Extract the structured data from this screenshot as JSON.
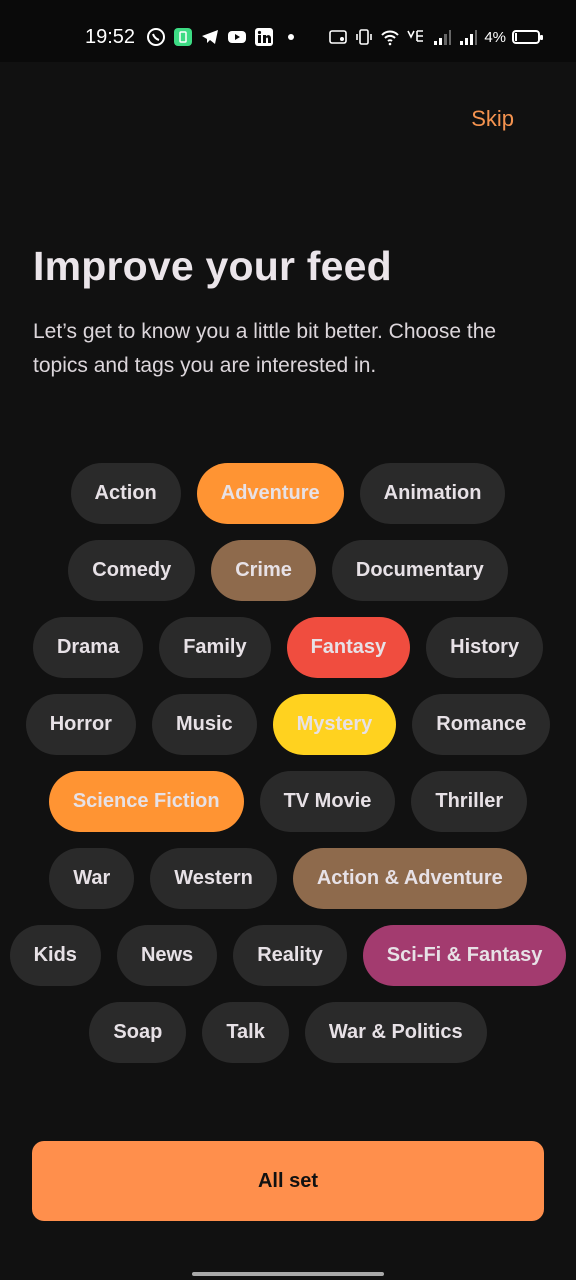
{
  "status_bar": {
    "time": "19:52",
    "battery_percent": "4%",
    "icons": [
      "whatsapp-icon",
      "battery-saver-icon",
      "telegram-icon",
      "youtube-icon",
      "linkedin-icon",
      "dot-icon",
      "cast-icon",
      "vibrate-icon",
      "wifi-icon",
      "volte-icon",
      "signal-icon",
      "signal-icon"
    ]
  },
  "header": {
    "skip_label": "Skip"
  },
  "main": {
    "title": "Improve your feed",
    "subtitle": "Let’s get to know you a little bit better. Choose the topics and tags you are interested in."
  },
  "tags": [
    [
      {
        "label": "Action",
        "selected": false,
        "color": "#2a2a2a"
      },
      {
        "label": "Adventure",
        "selected": true,
        "color": "#ff9433"
      },
      {
        "label": "Animation",
        "selected": false,
        "color": "#2a2a2a"
      }
    ],
    [
      {
        "label": "Comedy",
        "selected": false,
        "color": "#2a2a2a"
      },
      {
        "label": "Crime",
        "selected": true,
        "color": "#8e6a4c"
      },
      {
        "label": "Documentary",
        "selected": false,
        "color": "#2a2a2a"
      }
    ],
    [
      {
        "label": "Drama",
        "selected": false,
        "color": "#2a2a2a"
      },
      {
        "label": "Family",
        "selected": false,
        "color": "#2a2a2a"
      },
      {
        "label": "Fantasy",
        "selected": true,
        "color": "#f04d3f"
      },
      {
        "label": "History",
        "selected": false,
        "color": "#2a2a2a"
      }
    ],
    [
      {
        "label": "Horror",
        "selected": false,
        "color": "#2a2a2a"
      },
      {
        "label": "Music",
        "selected": false,
        "color": "#2a2a2a"
      },
      {
        "label": "Mystery",
        "selected": true,
        "color": "#ffd21f"
      },
      {
        "label": "Romance",
        "selected": false,
        "color": "#2a2a2a"
      }
    ],
    [
      {
        "label": "Science Fiction",
        "selected": true,
        "color": "#ff9433"
      },
      {
        "label": "TV Movie",
        "selected": false,
        "color": "#2a2a2a"
      },
      {
        "label": "Thriller",
        "selected": false,
        "color": "#2a2a2a"
      }
    ],
    [
      {
        "label": "War",
        "selected": false,
        "color": "#2a2a2a"
      },
      {
        "label": "Western",
        "selected": false,
        "color": "#2a2a2a"
      },
      {
        "label": "Action & Adventure",
        "selected": true,
        "color": "#8e6a4c"
      }
    ],
    [
      {
        "label": "Kids",
        "selected": false,
        "color": "#2a2a2a"
      },
      {
        "label": "News",
        "selected": false,
        "color": "#2a2a2a"
      },
      {
        "label": "Reality",
        "selected": false,
        "color": "#2a2a2a"
      },
      {
        "label": "Sci-Fi & Fantasy",
        "selected": true,
        "color": "#a33b6f"
      }
    ],
    [
      {
        "label": "Soap",
        "selected": false,
        "color": "#2a2a2a"
      },
      {
        "label": "Talk",
        "selected": false,
        "color": "#2a2a2a"
      },
      {
        "label": "War & Politics",
        "selected": false,
        "color": "#2a2a2a"
      }
    ]
  ],
  "footer": {
    "all_set_label": "All set"
  },
  "colors": {
    "background": "#111111",
    "accent": "#ff8f4c",
    "chip_default": "#2a2a2a"
  }
}
